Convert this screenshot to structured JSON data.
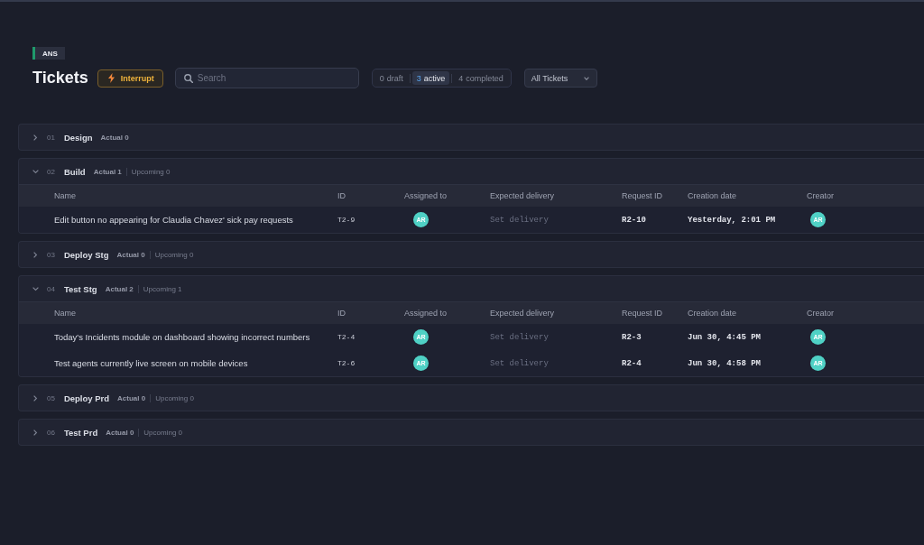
{
  "workspace_tag": "ANS",
  "title": "Tickets",
  "interrupt_button": "Interrupt",
  "search": {
    "placeholder": "Search"
  },
  "status_filter": [
    {
      "count": "0",
      "label": "draft",
      "selected": false
    },
    {
      "count": "3",
      "label": "active",
      "selected": true
    },
    {
      "count": "4",
      "label": "completed",
      "selected": false
    }
  ],
  "view_dropdown": "All Tickets",
  "stages": [
    {
      "number": "01",
      "name": "Design",
      "expanded": false,
      "actual": "Actual 0"
    },
    {
      "number": "02",
      "name": "Build",
      "expanded": true,
      "actual": "Actual 1",
      "upcoming": "Upcoming 0",
      "columns": [
        "Name",
        "ID",
        "Assigned to",
        "Expected delivery",
        "Request ID",
        "Creation date",
        "Creator"
      ],
      "rows": [
        {
          "name": "Edit button no appearing for Claudia Chavez' sick pay requests",
          "id": "T2-9",
          "assigned_to": "AR",
          "expected_delivery": "Set delivery",
          "request_id": "R2-10",
          "creation_date": "Yesterday, 2:01 PM",
          "creator": "AR"
        }
      ]
    },
    {
      "number": "03",
      "name": "Deploy Stg",
      "expanded": false,
      "actual": "Actual 0",
      "upcoming": "Upcoming 0"
    },
    {
      "number": "04",
      "name": "Test Stg",
      "expanded": true,
      "actual": "Actual 2",
      "upcoming": "Upcoming 1",
      "columns": [
        "Name",
        "ID",
        "Assigned to",
        "Expected delivery",
        "Request ID",
        "Creation date",
        "Creator"
      ],
      "rows": [
        {
          "name": "Today's Incidents module on dashboard showing incorrect numbers",
          "id": "T2-4",
          "assigned_to": "AR",
          "expected_delivery": "Set delivery",
          "request_id": "R2-3",
          "creation_date": "Jun 30, 4:45 PM",
          "creator": "AR"
        },
        {
          "name": "Test agents currently live screen on mobile devices",
          "id": "T2-6",
          "assigned_to": "AR",
          "expected_delivery": "Set delivery",
          "request_id": "R2-4",
          "creation_date": "Jun 30, 4:58 PM",
          "creator": "AR"
        }
      ]
    },
    {
      "number": "05",
      "name": "Deploy Prd",
      "expanded": false,
      "actual": "Actual 0",
      "upcoming": "Upcoming 0"
    },
    {
      "number": "06",
      "name": "Test Prd",
      "expanded": false,
      "actual": "Actual 0",
      "upcoming": "Upcoming 0"
    }
  ]
}
